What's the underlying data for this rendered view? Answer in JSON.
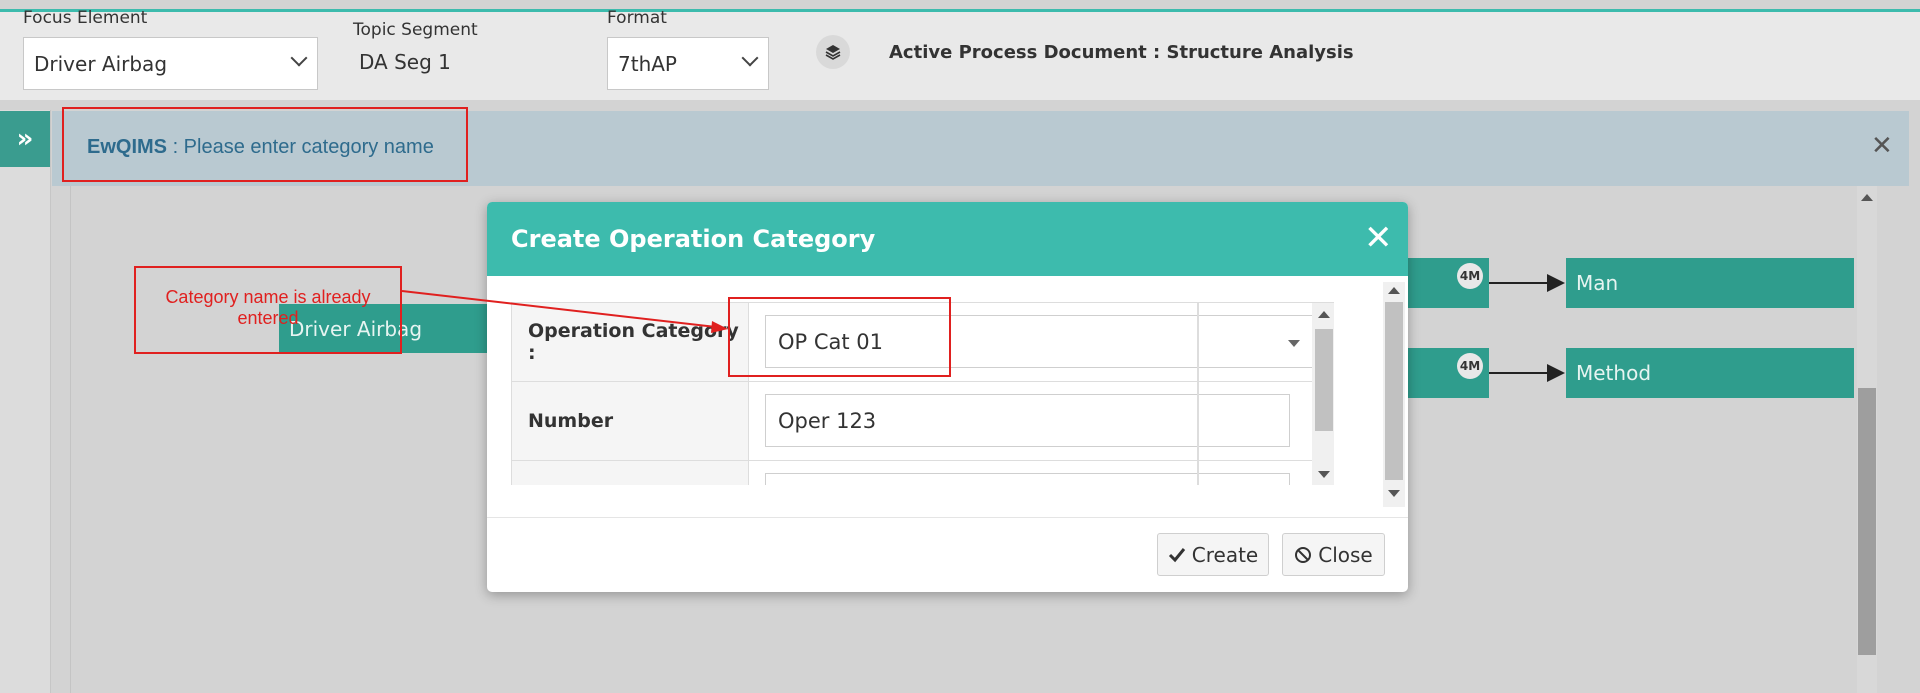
{
  "toolbar": {
    "focus_element_label": "Focus Element",
    "focus_element_value": "Driver Airbag",
    "topic_segment_label": "Topic Segment",
    "topic_segment_value": "DA Seg 1",
    "format_label": "Format",
    "format_value": "7thAP",
    "active_doc": "Active Process Document : Structure Analysis"
  },
  "sidebar": {
    "expand_icon": "double-chevron-right-icon",
    "expand_glyph": "»"
  },
  "banner": {
    "app": "EwQIMS",
    "message": " : Please enter category name",
    "close_glyph": "✕"
  },
  "diagram": {
    "root_node": "Driver Airbag",
    "badge": "4M",
    "nodes": [
      "Man",
      "Method"
    ]
  },
  "annotation": {
    "text": "Category name is already entered"
  },
  "modal": {
    "title": "Create Operation Category",
    "close_glyph": "✕",
    "fields": [
      {
        "label": "Operation Category :",
        "value": "OP Cat 01"
      },
      {
        "label": "Number",
        "value": "Oper 123"
      }
    ],
    "create_label": "Create",
    "close_label": "Close"
  },
  "colors": {
    "accent": "#3dbbad",
    "node": "#2f9d8d",
    "annotation": "#e0201f"
  }
}
